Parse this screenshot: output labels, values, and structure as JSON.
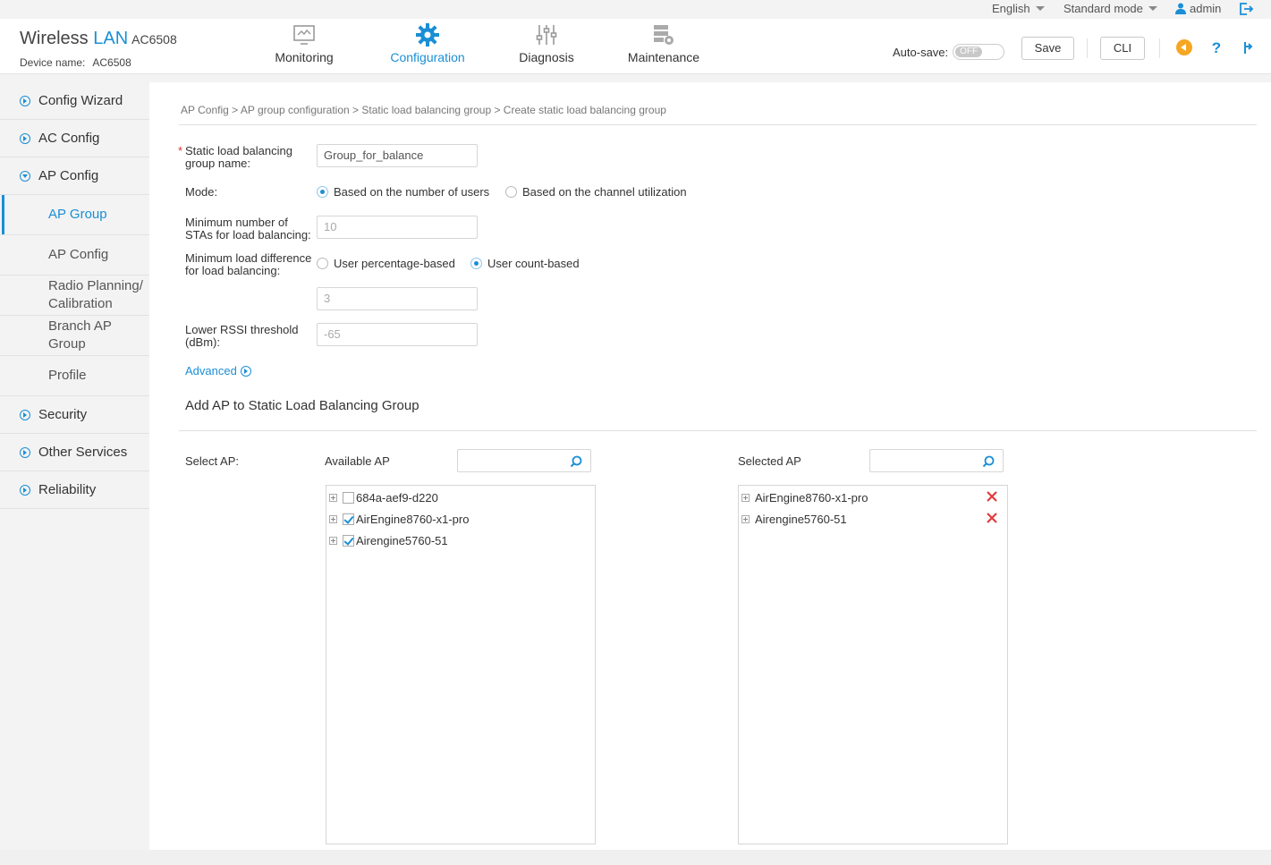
{
  "topbar": {
    "language": "English",
    "mode": "Standard mode",
    "user": "admin"
  },
  "brand": {
    "wireless": "Wireless",
    "lan": "LAN",
    "model": "AC6508",
    "device_label": "Device name:",
    "device_name": "AC6508"
  },
  "nav": {
    "tabs": [
      {
        "label": "Monitoring",
        "icon": "monitor-icon"
      },
      {
        "label": "Configuration",
        "icon": "gear-icon"
      },
      {
        "label": "Diagnosis",
        "icon": "sliders-icon"
      },
      {
        "label": "Maintenance",
        "icon": "server-gear-icon"
      }
    ],
    "active": "Configuration"
  },
  "toolbar": {
    "autosave_label": "Auto-save:",
    "autosave_state": "OFF",
    "save_label": "Save",
    "cli_label": "CLI"
  },
  "sidebar": {
    "items": [
      {
        "label": "Config Wizard"
      },
      {
        "label": "AC Config"
      },
      {
        "label": "AP Config"
      },
      {
        "label": "Security"
      },
      {
        "label": "Other Services"
      },
      {
        "label": "Reliability"
      }
    ],
    "sub_items": [
      {
        "label": "AP Group"
      },
      {
        "label": "AP Config"
      },
      {
        "label": "Radio Planning/",
        "label2": "Calibration"
      },
      {
        "label": "Branch AP",
        "label2": "Group"
      },
      {
        "label": "Profile"
      }
    ]
  },
  "breadcrumb": "AP Config > AP group configuration > Static load balancing group > Create static load balancing group",
  "form": {
    "group_name_label_1": "Static load balancing",
    "group_name_label_2": "group name:",
    "group_name_value": "Group_for_balance",
    "mode_label": "Mode:",
    "mode_option_users": "Based on the number of users",
    "mode_option_channel": "Based on the channel utilization",
    "min_sta_label_1": "Minimum number of",
    "min_sta_label_2": "STAs for load balancing:",
    "min_sta_value": "10",
    "min_diff_label_1": "Minimum load difference",
    "min_diff_label_2": "for load balancing:",
    "diff_option_percent": "User percentage-based",
    "diff_option_count": "User count-based",
    "min_diff_value": "3",
    "rssi_label_1": "Lower RSSI threshold",
    "rssi_label_2": "(dBm):",
    "rssi_value": "-65",
    "advanced_label": "Advanced"
  },
  "ap_section": {
    "title": "Add AP to Static Load Balancing Group",
    "select_label": "Select AP:",
    "available_label": "Available AP",
    "selected_label": "Selected AP",
    "available": [
      {
        "name": "684a-aef9-d220",
        "checked": false
      },
      {
        "name": "AirEngine8760-x1-pro",
        "checked": true
      },
      {
        "name": "Airengine5760-51",
        "checked": true
      }
    ],
    "selected": [
      {
        "name": "AirEngine8760-x1-pro"
      },
      {
        "name": "Airengine5760-51"
      }
    ]
  },
  "colors": {
    "accent": "#1a8fd6",
    "delete": "#e03c3c",
    "warn": "#f5a623"
  }
}
